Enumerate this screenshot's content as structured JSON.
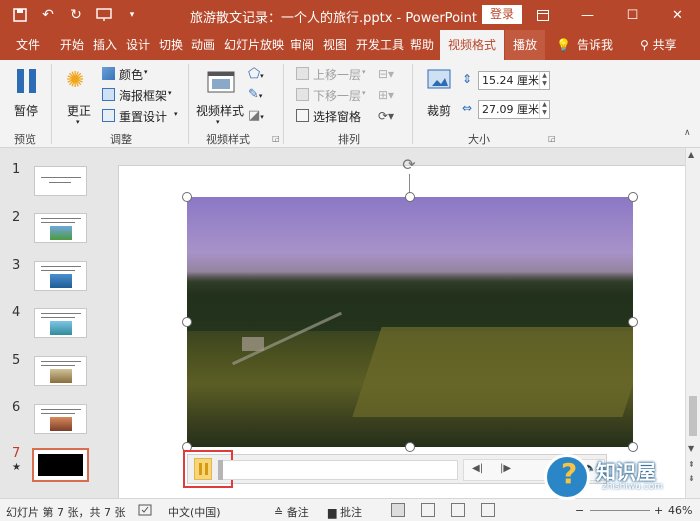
{
  "window": {
    "title": "旅游散文记录：一个人的旅行.pptx  -  PowerPoint",
    "login_label": "登录"
  },
  "tabs": [
    "文件",
    "开始",
    "插入",
    "设计",
    "切换",
    "动画",
    "幻灯片放映",
    "审阅",
    "视图",
    "开发工具",
    "帮助",
    "视频格式",
    "播放"
  ],
  "tell_me": "告诉我",
  "share": "共享",
  "ribbon": {
    "preview": {
      "pause_label": "暂停",
      "group": "预览"
    },
    "adjust": {
      "correct_label": "更正",
      "color_label": "颜色",
      "poster_label": "海报框架",
      "reset_label": "重置设计",
      "group": "调整"
    },
    "video_styles": {
      "styles_label": "视频样式",
      "group": "视频样式"
    },
    "arrange": {
      "bring_forward": "上移一层",
      "send_backward": "下移一层",
      "selection_pane": "选择窗格",
      "group": "排列"
    },
    "size": {
      "crop_label": "裁剪",
      "height": "15.24 厘米",
      "width": "27.09 厘米",
      "group": "大小"
    }
  },
  "slides": [
    {
      "number": "1"
    },
    {
      "number": "2"
    },
    {
      "number": "3"
    },
    {
      "number": "4"
    },
    {
      "number": "5"
    },
    {
      "number": "6"
    },
    {
      "number": "7",
      "star": "★"
    }
  ],
  "statusbar": {
    "slide_info": "幻灯片 第 7 张，共 7 张",
    "language": "中文(中国)",
    "notes": "备注",
    "comments": "批注",
    "zoom": "46%"
  },
  "watermark": {
    "name": "知识屋",
    "url": "zhishiwu.com"
  },
  "colors": {
    "accent": "#b7472a",
    "highlight": "#e03c3c"
  }
}
